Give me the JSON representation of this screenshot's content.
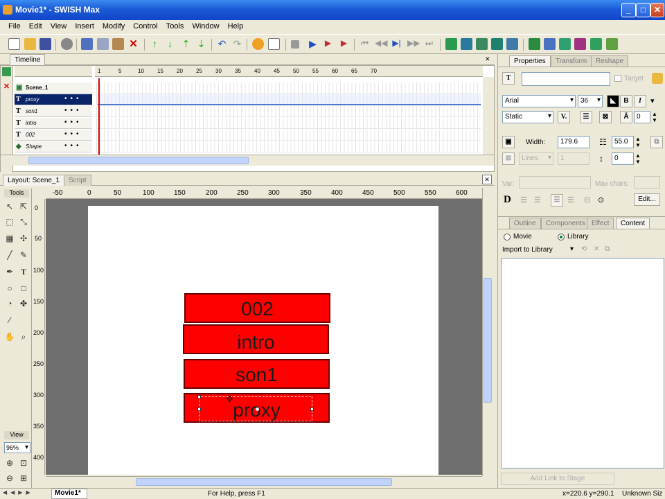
{
  "window": {
    "title": "Movie1* - SWISH Max"
  },
  "menu": [
    "File",
    "Edit",
    "View",
    "Insert",
    "Modify",
    "Control",
    "Tools",
    "Window",
    "Help"
  ],
  "timeline": {
    "tab": "Timeline",
    "ruler": [
      "1",
      "5",
      "10",
      "15",
      "20",
      "25",
      "30",
      "35",
      "40",
      "45",
      "50",
      "55",
      "60",
      "65",
      "70"
    ],
    "scene": "Scene_1",
    "layers": [
      {
        "name": "proxy",
        "type": "T"
      },
      {
        "name": "son1",
        "type": "T"
      },
      {
        "name": "intro",
        "type": "T"
      },
      {
        "name": "002",
        "type": "T"
      },
      {
        "name": "Shape",
        "type": "S"
      }
    ]
  },
  "layout": {
    "tabs": [
      "Layout: Scene_1",
      "Script"
    ],
    "tools_label": "Tools",
    "zoom": "96%",
    "hruler": [
      "-50",
      "0",
      "50",
      "100",
      "150",
      "200",
      "250",
      "300",
      "350",
      "400",
      "450",
      "500",
      "550",
      "600"
    ],
    "vruler": [
      "0",
      "50",
      "100",
      "150",
      "200",
      "250",
      "300",
      "350",
      "400"
    ],
    "boxes": [
      "002",
      "intro",
      "son1",
      "proxy"
    ]
  },
  "properties": {
    "tabs": [
      "Properties",
      "Transform",
      "Reshape"
    ],
    "target_label": "Target",
    "font": "Arial",
    "size": "36",
    "text_type": "Static",
    "kerning": "0",
    "width_label": "Width:",
    "width_value": "179.6",
    "height_value": "55.0",
    "lines_label": "Lines",
    "lines_value": "1",
    "line_spacing": "0",
    "var_label": "Var:",
    "max_chars_label": "Max chars:",
    "edit_button": "Edit..."
  },
  "content_panel": {
    "tabs": [
      "Outline",
      "Components",
      "Effect",
      "Content"
    ],
    "radio_movie": "Movie",
    "radio_library": "Library",
    "import_label": "Import to Library",
    "add_link_button": "Add Link to Stage"
  },
  "status": {
    "help": "For Help, press F1",
    "coords": "x=220.6 y=290.1",
    "size": "Unknown Siz",
    "movie_tab": "Movie1*"
  },
  "colors": {
    "accent": "#0a246a",
    "box": "#ff0000",
    "titlebar": "#0f46c8"
  }
}
